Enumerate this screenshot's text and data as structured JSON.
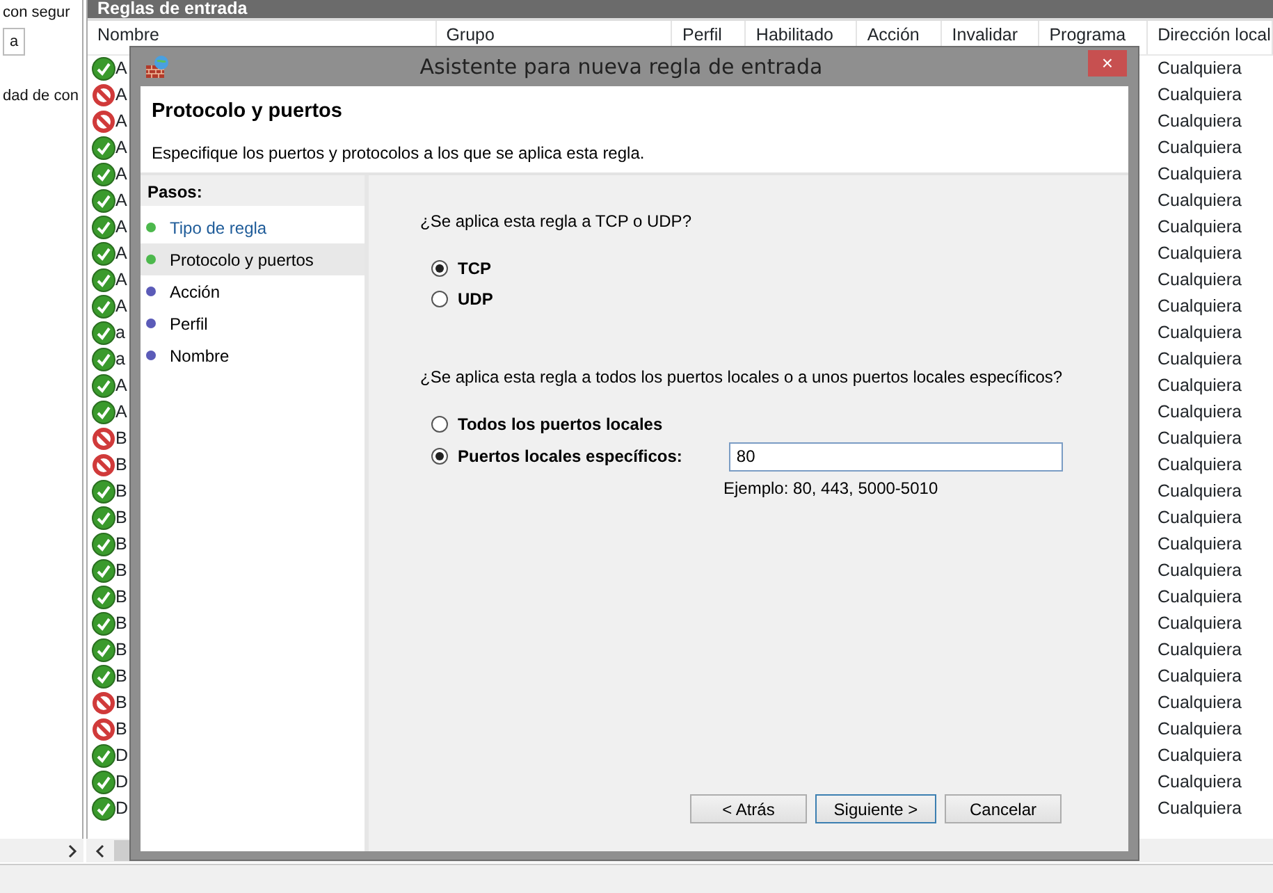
{
  "left_pane": {
    "lines": [
      {
        "text": "con segur",
        "kind": "text"
      },
      {
        "text": "a",
        "kind": "field"
      },
      {
        "text": "dad de con",
        "kind": "text"
      }
    ]
  },
  "rules_pane": {
    "title": "Reglas de entrada",
    "columns": [
      "Nombre",
      "Grupo",
      "Perfil",
      "Habilitado",
      "Acción",
      "Invalidar",
      "Programa",
      "Dirección local"
    ],
    "rows": [
      {
        "blocked": false,
        "name": "A",
        "local_address": "Cualquiera"
      },
      {
        "blocked": true,
        "name": "A",
        "local_address": "Cualquiera"
      },
      {
        "blocked": true,
        "name": "A",
        "local_address": "Cualquiera"
      },
      {
        "blocked": false,
        "name": "A",
        "local_address": "Cualquiera"
      },
      {
        "blocked": false,
        "name": "A",
        "local_address": "Cualquiera"
      },
      {
        "blocked": false,
        "name": "A",
        "local_address": "Cualquiera"
      },
      {
        "blocked": false,
        "name": "A",
        "local_address": "Cualquiera"
      },
      {
        "blocked": false,
        "name": "A",
        "local_address": "Cualquiera"
      },
      {
        "blocked": false,
        "name": "A",
        "local_address": "Cualquiera"
      },
      {
        "blocked": false,
        "name": "A",
        "local_address": "Cualquiera"
      },
      {
        "blocked": false,
        "name": "a",
        "local_address": "Cualquiera"
      },
      {
        "blocked": false,
        "name": "a",
        "local_address": "Cualquiera"
      },
      {
        "blocked": false,
        "name": "A",
        "local_address": "Cualquiera"
      },
      {
        "blocked": false,
        "name": "A",
        "local_address": "Cualquiera"
      },
      {
        "blocked": true,
        "name": "B",
        "local_address": "Cualquiera"
      },
      {
        "blocked": true,
        "name": "B",
        "local_address": "Cualquiera"
      },
      {
        "blocked": false,
        "name": "B",
        "local_address": "Cualquiera"
      },
      {
        "blocked": false,
        "name": "B",
        "local_address": "Cualquiera"
      },
      {
        "blocked": false,
        "name": "B",
        "local_address": "Cualquiera"
      },
      {
        "blocked": false,
        "name": "B",
        "local_address": "Cualquiera"
      },
      {
        "blocked": false,
        "name": "B",
        "local_address": "Cualquiera"
      },
      {
        "blocked": false,
        "name": "B",
        "local_address": "Cualquiera"
      },
      {
        "blocked": false,
        "name": "B",
        "local_address": "Cualquiera"
      },
      {
        "blocked": false,
        "name": "B",
        "local_address": "Cualquiera"
      },
      {
        "blocked": true,
        "name": "B",
        "local_address": "Cualquiera"
      },
      {
        "blocked": true,
        "name": "B",
        "local_address": "Cualquiera"
      },
      {
        "blocked": false,
        "name": "D",
        "local_address": "Cualquiera"
      },
      {
        "blocked": false,
        "name": "D",
        "local_address": "Cualquiera"
      },
      {
        "blocked": false,
        "name": "D",
        "local_address": "Cualquiera"
      }
    ]
  },
  "dialog": {
    "title": "Asistente para nueva regla de entrada",
    "close": "×",
    "heading": "Protocolo y puertos",
    "description": "Especifique los puertos y protocolos a los que se aplica esta regla.",
    "steps_title": "Pasos:",
    "steps": [
      {
        "label": "Tipo de regla",
        "selected": false,
        "link": true,
        "color": "#4cb84c"
      },
      {
        "label": "Protocolo y puertos",
        "selected": true,
        "link": false,
        "color": "#4cb84c"
      },
      {
        "label": "Acción",
        "selected": false,
        "link": false,
        "color": "#5b5bb8"
      },
      {
        "label": "Perfil",
        "selected": false,
        "link": false,
        "color": "#5b5bb8"
      },
      {
        "label": "Nombre",
        "selected": false,
        "link": false,
        "color": "#5b5bb8"
      }
    ],
    "protocol_question": "¿Se aplica esta regla a TCP o UDP?",
    "protocol_options": [
      {
        "label": "TCP",
        "selected": true
      },
      {
        "label": "UDP",
        "selected": false
      }
    ],
    "ports_question": "¿Se aplica esta regla a todos los puertos locales o a unos puertos locales específicos?",
    "ports_options": [
      {
        "kind": "plain",
        "label": "Todos los puertos locales",
        "selected": false
      },
      {
        "kind": "field",
        "label": "Puertos locales específicos:",
        "selected": true,
        "value": "80",
        "hint": "Ejemplo: 80, 443, 5000-5010"
      }
    ],
    "buttons": [
      {
        "label": "< Atrás",
        "default": false
      },
      {
        "label": "Siguiente >",
        "default": true
      },
      {
        "label": "Cancelar",
        "default": false
      }
    ]
  }
}
